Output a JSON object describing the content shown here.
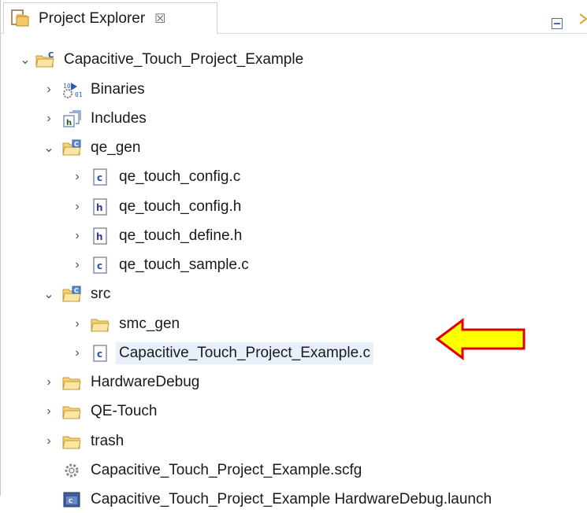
{
  "panel": {
    "tab_title": "Project Explorer",
    "tab_close_glyph": "☒",
    "tab_icon": "project-explorer-icon",
    "toolbar": [
      {
        "name": "collapse-all-icon"
      },
      {
        "name": "link-with-editor-icon"
      }
    ]
  },
  "tree": [
    {
      "label": "Capacitive_Touch_Project_Example",
      "expanded": true,
      "icon": "c-project-icon"
    },
    {
      "label": "Binaries",
      "expanded": false,
      "icon": "binaries-icon"
    },
    {
      "label": "Includes",
      "expanded": false,
      "icon": "includes-icon"
    },
    {
      "label": "qe_gen",
      "expanded": true,
      "icon": "source-folder-icon"
    },
    {
      "label": "qe_touch_config.c",
      "expanded": false,
      "icon": "c-file-icon"
    },
    {
      "label": "qe_touch_config.h",
      "expanded": false,
      "icon": "h-file-icon"
    },
    {
      "label": "qe_touch_define.h",
      "expanded": false,
      "icon": "h-file-icon"
    },
    {
      "label": "qe_touch_sample.c",
      "expanded": false,
      "icon": "c-file-icon"
    },
    {
      "label": "src",
      "expanded": true,
      "icon": "source-folder-icon"
    },
    {
      "label": "smc_gen",
      "expanded": false,
      "icon": "folder-icon"
    },
    {
      "label": "Capacitive_Touch_Project_Example.c",
      "expanded": false,
      "icon": "c-file-icon",
      "selected": true
    },
    {
      "label": "HardwareDebug",
      "expanded": false,
      "icon": "folder-icon"
    },
    {
      "label": "QE-Touch",
      "expanded": false,
      "icon": "folder-icon"
    },
    {
      "label": "trash",
      "expanded": false,
      "icon": "folder-icon"
    },
    {
      "label": "Capacitive_Touch_Project_Example.scfg",
      "icon": "config-gear-icon"
    },
    {
      "label": "Capacitive_Touch_Project_Example HardwareDebug.launch",
      "icon": "launch-icon"
    }
  ],
  "annotation": {
    "icon": "yellow-arrow-left",
    "fill": "#ffff00",
    "stroke": "#e00000"
  },
  "colors": {
    "selection": "#e8f1fb",
    "folder": "#f5d27a",
    "project_blue": "#3a6ea5"
  }
}
